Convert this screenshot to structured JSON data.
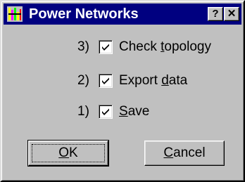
{
  "window": {
    "title": "Power Networks",
    "help_label": "?",
    "close_label": "✕"
  },
  "options": [
    {
      "order": "3)",
      "label_pre": "Check ",
      "label_mnemonic": "t",
      "label_post": "opology",
      "checked": true
    },
    {
      "order": "2)",
      "label_pre": "Export ",
      "label_mnemonic": "d",
      "label_post": "ata",
      "checked": true
    },
    {
      "order": "1)",
      "label_pre": "",
      "label_mnemonic": "S",
      "label_post": "ave",
      "checked": true
    }
  ],
  "buttons": {
    "ok_mnemonic": "O",
    "ok_rest": "K",
    "cancel_mnemonic": "C",
    "cancel_rest": "ancel"
  },
  "icons": {
    "app": "power-networks-app-icon",
    "check": "checkmark-icon"
  },
  "colors": {
    "titlebar": "#000080",
    "face": "#c0c0c0"
  }
}
